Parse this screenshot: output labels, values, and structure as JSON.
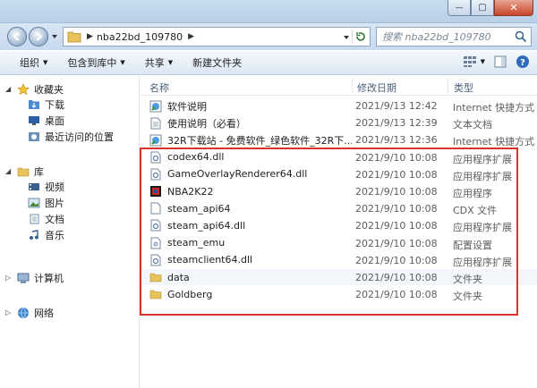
{
  "window": {
    "controls": {
      "minimize": "—",
      "maximize": "▢",
      "close": "✕"
    }
  },
  "address": {
    "path": "nba22bd_109780",
    "search_placeholder": "搜索 nba22bd_109780"
  },
  "toolbar": {
    "organize": "组织",
    "include_in_library": "包含到库中",
    "share": "共享",
    "new_folder": "新建文件夹"
  },
  "nav": {
    "favorites": "收藏夹",
    "favorites_items": [
      "下载",
      "桌面",
      "最近访问的位置"
    ],
    "libraries": "库",
    "libraries_items": [
      "视频",
      "图片",
      "文档",
      "音乐"
    ],
    "computer": "计算机",
    "network": "网络"
  },
  "columns": {
    "name": "名称",
    "date": "修改日期",
    "type": "类型"
  },
  "files": [
    {
      "name": "软件说明",
      "date": "2021/9/13 12:42",
      "type": "Internet 快捷方式",
      "icon": "internet-shortcut-icon"
    },
    {
      "name": "使用说明（必看）",
      "date": "2021/9/13 12:39",
      "type": "文本文档",
      "icon": "text-document-icon"
    },
    {
      "name": "32R下载站 - 免费软件_绿色软件_32R下...",
      "date": "2021/9/13 12:36",
      "type": "Internet 快捷方式",
      "icon": "internet-shortcut-icon"
    },
    {
      "name": "codex64.dll",
      "date": "2021/9/10 10:08",
      "type": "应用程序扩展",
      "icon": "dll-icon"
    },
    {
      "name": "GameOverlayRenderer64.dll",
      "date": "2021/9/10 10:08",
      "type": "应用程序扩展",
      "icon": "dll-icon"
    },
    {
      "name": "NBA2K22",
      "date": "2021/9/10 10:08",
      "type": "应用程序",
      "icon": "application-icon"
    },
    {
      "name": "steam_api64",
      "date": "2021/9/10 10:08",
      "type": "CDX 文件",
      "icon": "blank-file-icon"
    },
    {
      "name": "steam_api64.dll",
      "date": "2021/9/10 10:08",
      "type": "应用程序扩展",
      "icon": "dll-icon"
    },
    {
      "name": "steam_emu",
      "date": "2021/9/10 10:08",
      "type": "配置设置",
      "icon": "config-file-icon"
    },
    {
      "name": "steamclient64.dll",
      "date": "2021/9/10 10:08",
      "type": "应用程序扩展",
      "icon": "dll-icon"
    },
    {
      "name": "data",
      "date": "2021/9/10 10:08",
      "type": "文件夹",
      "icon": "folder-icon"
    },
    {
      "name": "Goldberg",
      "date": "2021/9/10 10:08",
      "type": "文件夹",
      "icon": "folder-icon"
    }
  ],
  "colors": {
    "highlight_box": "#d9342b",
    "folder": "#e8c35a",
    "accent": "#3a6ea5"
  }
}
